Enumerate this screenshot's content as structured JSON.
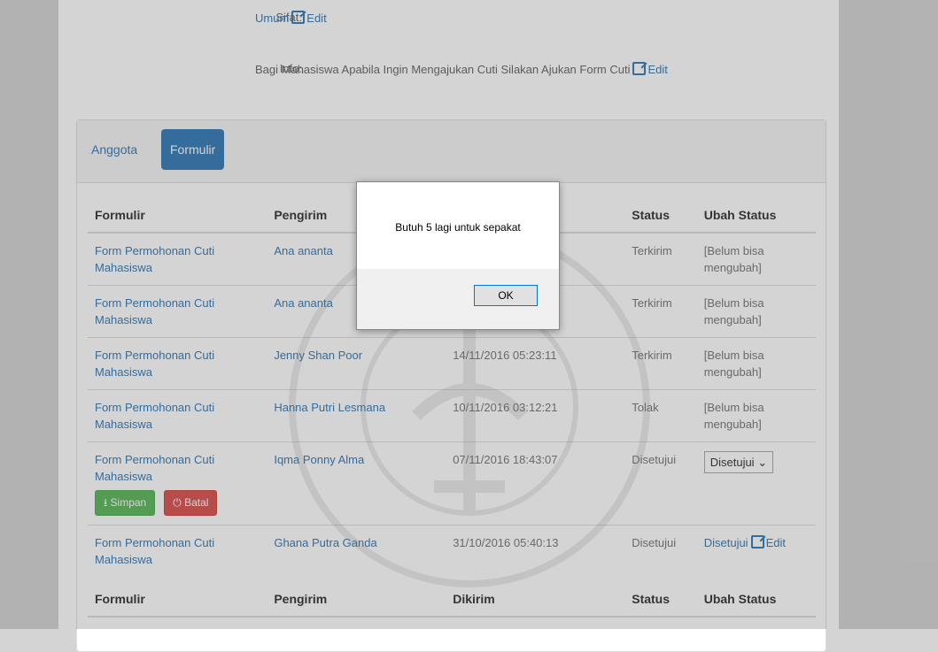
{
  "meta": {
    "sifat": {
      "label": "Sifat:",
      "value": "Umum",
      "edit": "Edit"
    },
    "info": {
      "label": "Info:",
      "value": "Bagi Mahasiswa Apabila Ingin Mengajukan Cuti Silakan Ajukan Form Cuti",
      "edit": "Edit"
    }
  },
  "tabs": [
    {
      "label": "Anggota"
    },
    {
      "label": "Formulir"
    }
  ],
  "table": {
    "headers": [
      "Formulir",
      "Pengirim",
      "Dikirim",
      "Status",
      "Ubah Status"
    ],
    "rows": [
      {
        "form": "Form Permohonan Cuti Mahasiswa",
        "sender": "Ana ananta",
        "date": "",
        "status": "Terkirim",
        "change": "[Belum bisa mengubah]"
      },
      {
        "form": "Form Permohonan Cuti Mahasiswa",
        "sender": "Ana ananta",
        "date": "",
        "status": "Terkirim",
        "change": "[Belum bisa mengubah]"
      },
      {
        "form": "Form Permohonan Cuti Mahasiswa",
        "sender": "Jenny Shan Poor",
        "date": "14/11/2016 05:23:11",
        "status": "Terkirim",
        "change": "[Belum bisa mengubah]"
      },
      {
        "form": "Form Permohonan Cuti Mahasiswa",
        "sender": "Hanna Putri Lesmana",
        "date": "10/11/2016 03:12:21",
        "status": "Tolak",
        "change": "[Belum bisa mengubah]"
      },
      {
        "form": "Form Permohonan Cuti Mahasiswa",
        "sender": "Iqma Ponny Alma",
        "date": "07/11/2016 18:43:07",
        "status": "Disetujui",
        "change": "Disetujui"
      },
      {
        "form": "Form Permohonan Cuti Mahasiswa",
        "sender": "Ghana Putra Ganda",
        "date": "31/10/2016 05:40:13",
        "status": "Disetujui",
        "change": "Disetujui",
        "edit": "Edit"
      }
    ],
    "buttons": {
      "save": "Simpan",
      "cancel": "Batal"
    }
  },
  "dialog": {
    "message": "Butuh 5 lagi untuk sepakat",
    "ok": "OK"
  },
  "colors": {
    "link": "#337ab7",
    "primary": "#337ab7",
    "success": "#5cb85c",
    "danger": "#d9534f"
  }
}
